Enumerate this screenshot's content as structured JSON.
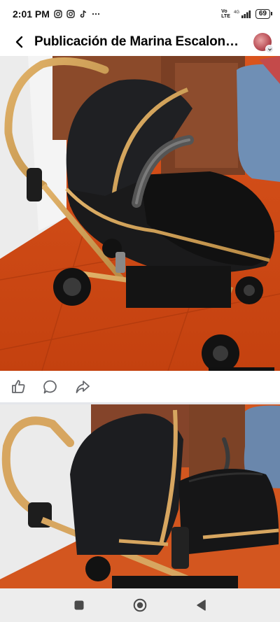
{
  "status_bar": {
    "time": "2:01 PM",
    "network_top": "Vo",
    "network_bottom": "LTE",
    "signal_label": "4G",
    "battery": "69"
  },
  "app_bar": {
    "title": "Publicación de Marina Escalon…"
  },
  "colors": {
    "accent": "#1877f2",
    "text": "#050505",
    "divider": "#e4e6eb"
  },
  "icons": {
    "back": "arrow-left-icon",
    "like": "thumbs-up-icon",
    "comment": "speech-bubble-icon",
    "share": "share-arrow-icon",
    "nav_recents": "square-icon",
    "nav_home": "circle-icon",
    "nav_back": "triangle-back-icon"
  }
}
